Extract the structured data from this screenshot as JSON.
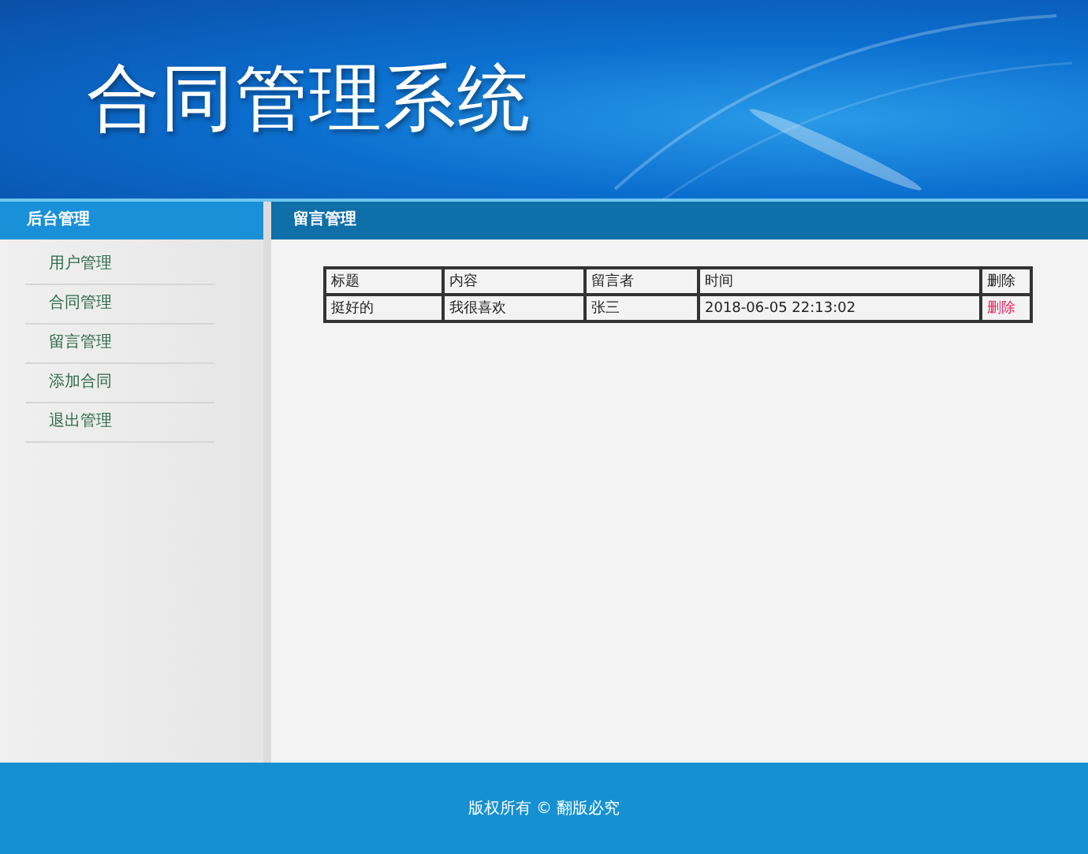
{
  "header": {
    "title": "合同管理系统"
  },
  "sidebar": {
    "heading": "后台管理",
    "items": [
      {
        "label": "用户管理"
      },
      {
        "label": "合同管理"
      },
      {
        "label": "留言管理"
      },
      {
        "label": "添加合同"
      },
      {
        "label": "退出管理"
      }
    ]
  },
  "main": {
    "heading": "留言管理",
    "table": {
      "columns": [
        "标题",
        "内容",
        "留言者",
        "时间",
        "删除"
      ],
      "rows": [
        {
          "cells": [
            "挺好的",
            "我很喜欢",
            "张三",
            "2018-06-05 22:13:02"
          ],
          "action": "删除"
        }
      ]
    }
  },
  "footer": {
    "text": "版权所有 © 翻版必究"
  }
}
